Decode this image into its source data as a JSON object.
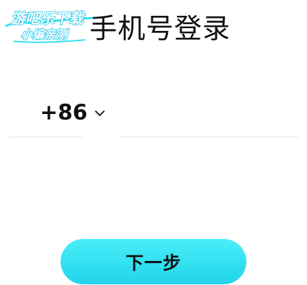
{
  "watermark": {
    "line1": "游吧乐下载",
    "line2": "小编亲测",
    "colors": {
      "fill": "#ffffff",
      "stroke": "#1fc8e8",
      "accent": "#33ddee"
    }
  },
  "header": {
    "title": "手机号登录"
  },
  "phone": {
    "country_code": "+86",
    "dropdown_icon": "chevron-down-icon",
    "value": "",
    "placeholder": ""
  },
  "actions": {
    "next_label": "下一步",
    "button_color": "#33e0f2"
  }
}
